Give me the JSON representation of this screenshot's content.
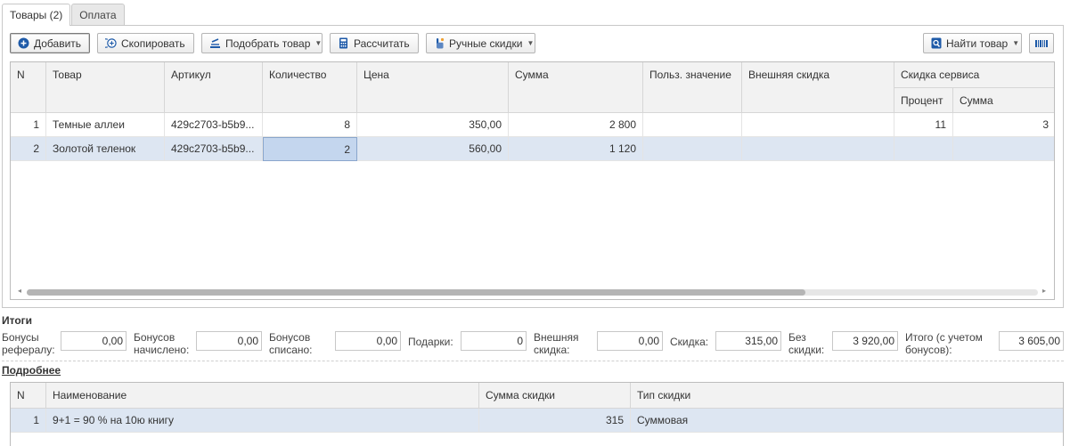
{
  "tabs": [
    {
      "label": "Товары (2)"
    },
    {
      "label": "Оплата"
    }
  ],
  "toolbar": {
    "add": "Добавить",
    "copy": "Скопировать",
    "pick": "Подобрать товар",
    "calc": "Рассчитать",
    "manual": "Ручные скидки",
    "find": "Найти товар"
  },
  "grid": {
    "headers": {
      "n": "N",
      "product": "Товар",
      "article": "Артикул",
      "qty": "Количество",
      "price": "Цена",
      "sum": "Сумма",
      "user_value": "Польз. значение",
      "ext_discount": "Внешняя скидка",
      "service_discount": "Скидка сервиса",
      "percent": "Процент",
      "amount": "Сумма"
    },
    "rows": [
      {
        "n": "1",
        "product": "Темные аллеи",
        "article": "429c2703-b5b9...",
        "qty": "8",
        "price": "350,00",
        "sum": "2 800",
        "user_value": "",
        "ext_discount": "",
        "percent": "11",
        "amount": "3"
      },
      {
        "n": "2",
        "product": "Золотой теленок",
        "article": "429c2703-b5b9...",
        "qty": "2",
        "price": "560,00",
        "sum": "1 120",
        "user_value": "",
        "ext_discount": "",
        "percent": "",
        "amount": ""
      }
    ],
    "scroll_fraction": 0.77
  },
  "totals": {
    "title": "Итоги",
    "referral_label": "Бонусы рефералу:",
    "referral_value": "0,00",
    "accrued_label": "Бонусов начислено:",
    "accrued_value": "0,00",
    "spent_label": "Бонусов списано:",
    "spent_value": "0,00",
    "gifts_label": "Подарки:",
    "gifts_value": "0",
    "ext_label": "Внешняя скидка:",
    "ext_value": "0,00",
    "discount_label": "Скидка:",
    "discount_value": "315,00",
    "no_discount_label": "Без скидки:",
    "no_discount_value": "3 920,00",
    "total_label": "Итого (с учетом бонусов):",
    "total_value": "3 605,00"
  },
  "details": {
    "title": "Подробнее",
    "headers": {
      "n": "N",
      "name": "Наименование",
      "sum": "Сумма скидки",
      "type": "Тип скидки"
    },
    "rows": [
      {
        "n": "1",
        "name": "9+1 = 90 % на 10ю книгу",
        "sum": "315",
        "type": "Суммовая"
      }
    ]
  },
  "colors": {
    "accent": "#1e5aa8",
    "selected_row": "#dde6f2",
    "edit_cell": "#c4d6ee"
  }
}
